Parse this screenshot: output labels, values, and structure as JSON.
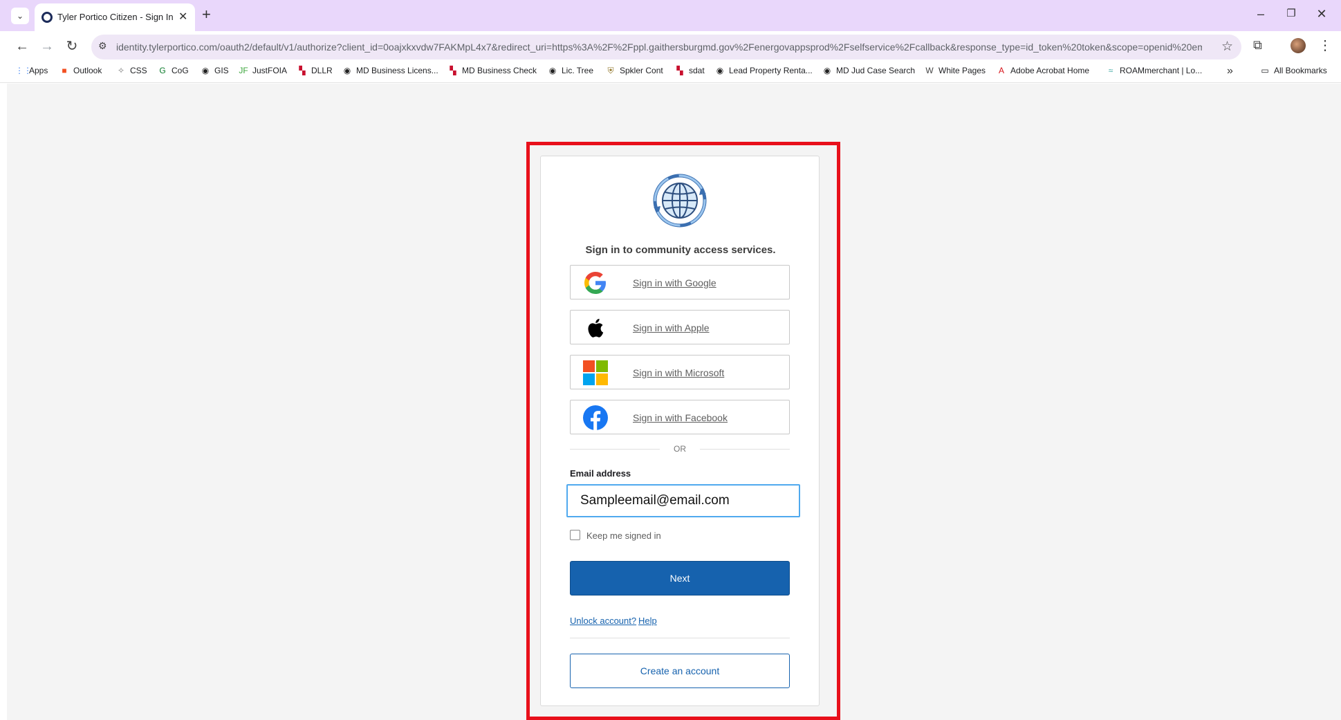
{
  "browser": {
    "tab_title": "Tyler Portico Citizen - Sign In",
    "tab_close": "✕",
    "new_tab": "+",
    "url": "identity.tylerportico.com/oauth2/default/v1/authorize?client_id=0oajxkxvdw7FAKMpL4x7&redirect_uri=https%3A%2F%2Fppl.gaithersburgmd.gov%2Fenergovappsprod%2Fselfservice%2Fcallback&response_type=id_token%20token&scope=openid%20em...",
    "window_controls": {
      "minimize": "–",
      "restore": "❐",
      "close": "✕"
    }
  },
  "bookmarks": [
    {
      "label": "Apps",
      "icon": "apps-grid-icon",
      "glyph": "⋮⋮",
      "color": "#4285f4"
    },
    {
      "label": "Outlook",
      "icon": "outlook-icon",
      "glyph": "■",
      "color": "#f25022"
    },
    {
      "label": "CSS",
      "icon": "css-icon",
      "glyph": "✧",
      "color": "#777777"
    },
    {
      "label": "CoG",
      "icon": "cog-icon",
      "glyph": "G",
      "color": "#0a7a2a"
    },
    {
      "label": "GIS",
      "icon": "globe-icon",
      "glyph": "◉",
      "color": "#222222"
    },
    {
      "label": "JustFOIA",
      "icon": "justfoia-icon",
      "glyph": "JF",
      "color": "#3aa53a"
    },
    {
      "label": "DLLR",
      "icon": "maryland-flag-icon",
      "glyph": "▚",
      "color": "#c8102e"
    },
    {
      "label": "MD Business Licens...",
      "icon": "globe-icon",
      "glyph": "◉",
      "color": "#222222"
    },
    {
      "label": "MD Business Check",
      "icon": "maryland-flag-icon",
      "glyph": "▚",
      "color": "#c8102e"
    },
    {
      "label": "Lic. Tree",
      "icon": "globe-icon",
      "glyph": "◉",
      "color": "#222222"
    },
    {
      "label": "Spkler Cont",
      "icon": "shield-icon",
      "glyph": "⛨",
      "color": "#8a6d1b"
    },
    {
      "label": "sdat",
      "icon": "maryland-flag-icon",
      "glyph": "▚",
      "color": "#c8102e"
    },
    {
      "label": "Lead Property Renta...",
      "icon": "globe-icon",
      "glyph": "◉",
      "color": "#222222"
    },
    {
      "label": "MD Jud Case Search",
      "icon": "globe-icon",
      "glyph": "◉",
      "color": "#222222"
    },
    {
      "label": "White Pages",
      "icon": "whitepages-icon",
      "glyph": "W",
      "color": "#444444"
    },
    {
      "label": "Adobe Acrobat Home",
      "icon": "acrobat-icon",
      "glyph": "A",
      "color": "#d7141a"
    },
    {
      "label": "ROAMmerchant | Lo...",
      "icon": "roam-icon",
      "glyph": "≈",
      "color": "#3fa9a3"
    }
  ],
  "bookmarks_more": "»",
  "bookmarks_all": "All Bookmarks",
  "signin": {
    "heading": "Sign in to community access services.",
    "providers": [
      {
        "label": "Sign in with Google",
        "icon": "google-icon"
      },
      {
        "label": "Sign in with Apple",
        "icon": "apple-icon"
      },
      {
        "label": "Sign in with Microsoft",
        "icon": "microsoft-icon"
      },
      {
        "label": "Sign in with Facebook",
        "icon": "facebook-icon"
      }
    ],
    "or_text": "OR",
    "email_label": "Email address",
    "email_value": "Sampleemail@email.com",
    "keep_signed_in": "Keep me signed in",
    "keep_signed_in_checked": false,
    "next_label": "Next",
    "unlock_link": "Unlock account?",
    "help_link": "Help",
    "create_label": "Create an account"
  },
  "colors": {
    "highlight_border": "#e8101b",
    "primary_button": "#1662ae",
    "input_focus": "#4fa9ee",
    "tabbar": "#e9d7fb"
  }
}
